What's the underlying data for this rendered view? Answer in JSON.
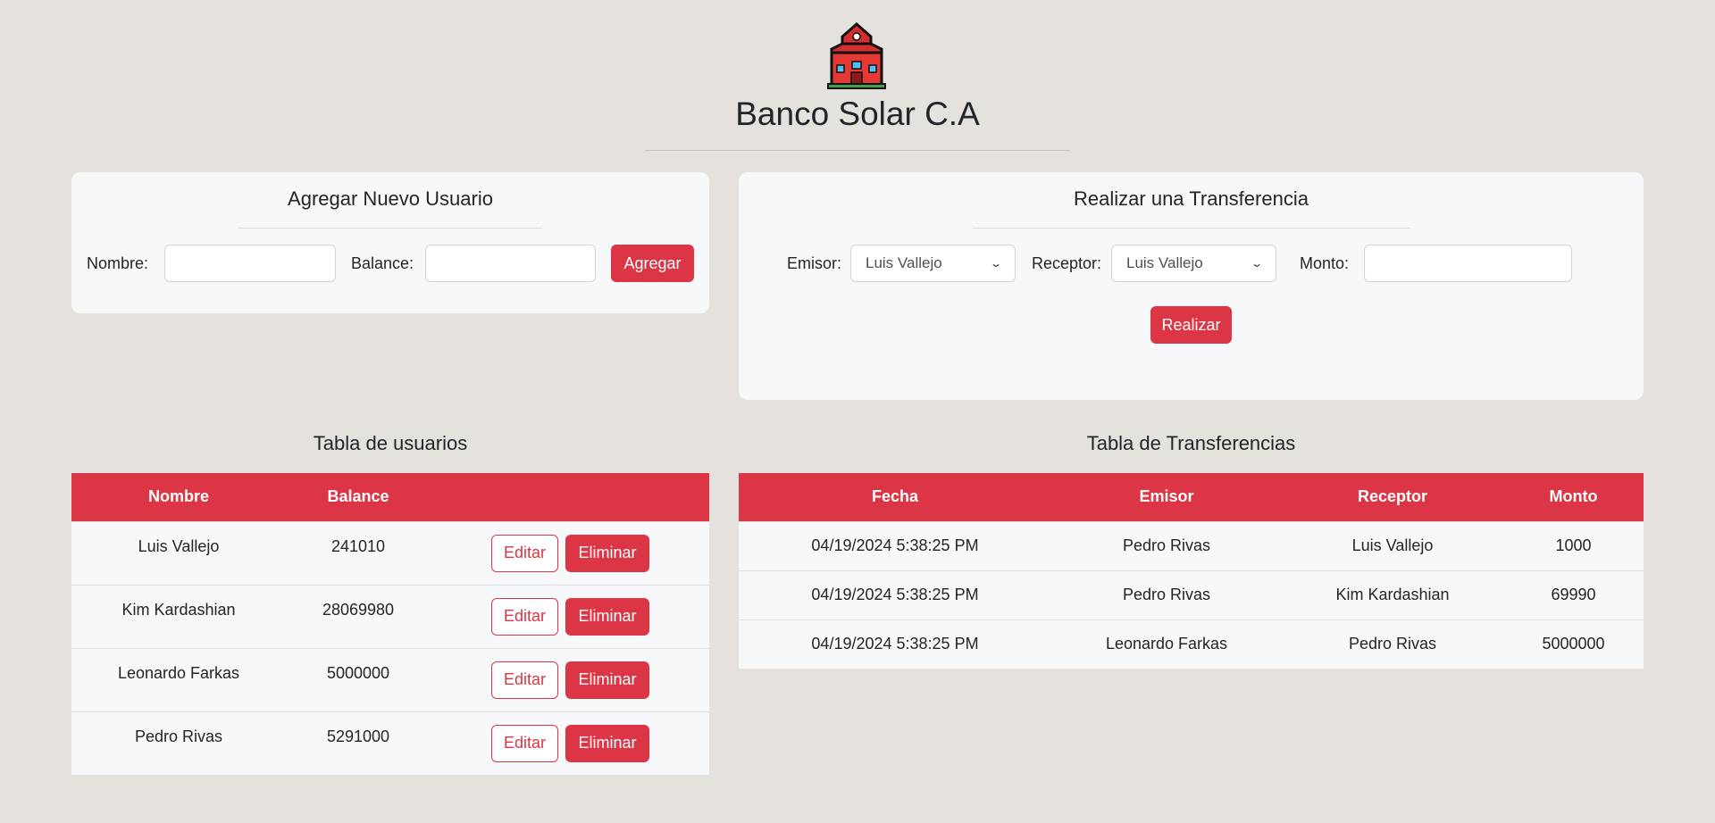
{
  "app": {
    "title": "Banco Solar C.A",
    "logo_icon": "school-building-icon"
  },
  "new_user": {
    "title": "Agregar Nuevo Usuario",
    "name_label": "Nombre:",
    "name_value": "",
    "balance_label": "Balance:",
    "balance_value": "",
    "submit_label": "Agregar"
  },
  "transfer": {
    "title": "Realizar una Transferencia",
    "sender_label": "Emisor:",
    "sender_selected": "Luis Vallejo",
    "receiver_label": "Receptor:",
    "receiver_selected": "Luis Vallejo",
    "amount_label": "Monto:",
    "amount_value": "",
    "submit_label": "Realizar"
  },
  "users_table": {
    "title": "Tabla de usuarios",
    "columns": [
      "Nombre",
      "Balance",
      ""
    ],
    "edit_label": "Editar",
    "delete_label": "Eliminar",
    "rows": [
      {
        "name": "Luis Vallejo",
        "balance": "241010"
      },
      {
        "name": "Kim Kardashian",
        "balance": "28069980"
      },
      {
        "name": "Leonardo Farkas",
        "balance": "5000000"
      },
      {
        "name": "Pedro Rivas",
        "balance": "5291000"
      }
    ]
  },
  "transfers_table": {
    "title": "Tabla de Transferencias",
    "columns": [
      "Fecha",
      "Emisor",
      "Receptor",
      "Monto"
    ],
    "rows": [
      {
        "date": "04/19/2024 5:38:25 PM",
        "sender": "Pedro Rivas",
        "receiver": "Luis Vallejo",
        "amount": "1000"
      },
      {
        "date": "04/19/2024 5:38:25 PM",
        "sender": "Pedro Rivas",
        "receiver": "Kim Kardashian",
        "amount": "69990"
      },
      {
        "date": "04/19/2024 5:38:25 PM",
        "sender": "Leonardo Farkas",
        "receiver": "Pedro Rivas",
        "amount": "5000000"
      }
    ]
  },
  "colors": {
    "background": "#e5e2dd",
    "card": "#f7f8fa",
    "accent": "#dc3545"
  }
}
